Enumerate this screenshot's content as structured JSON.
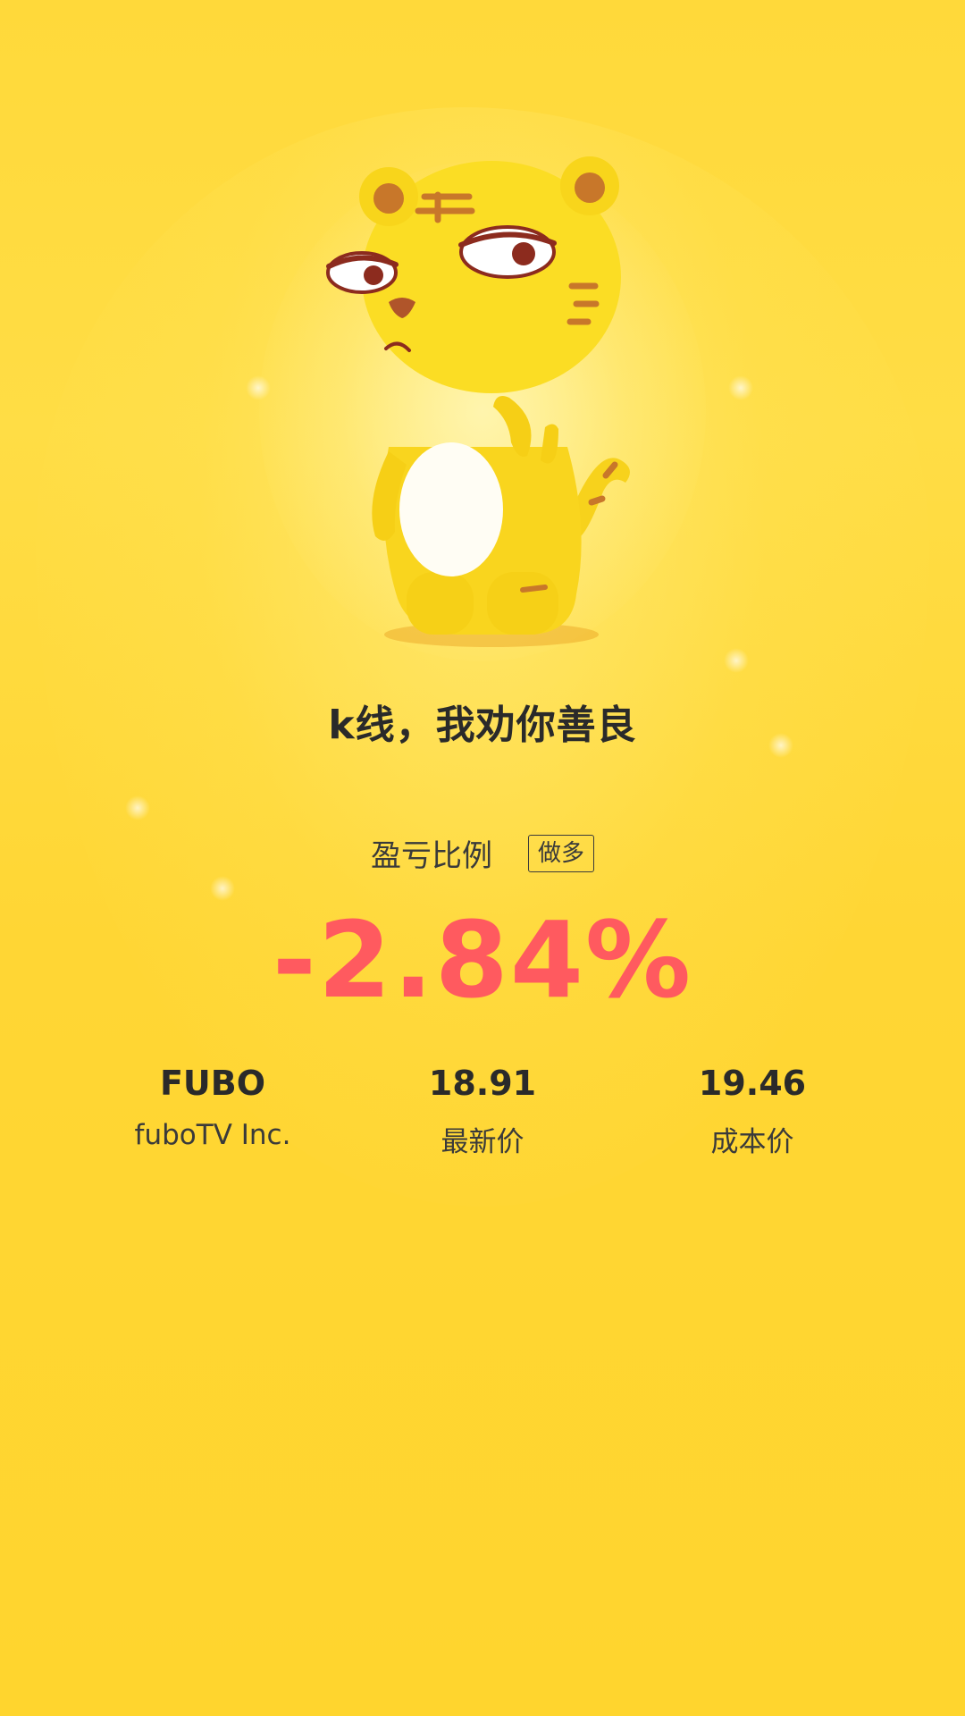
{
  "slogan": "k线，我劝你善良",
  "ratio": {
    "label": "盈亏比例",
    "direction_badge": "做多",
    "value": "-2.84%",
    "value_color": "#FF5A5F"
  },
  "stats": {
    "symbol": "FUBO",
    "company": "fuboTV Inc.",
    "latest_price": "18.91",
    "latest_price_label": "最新价",
    "cost_price": "19.46",
    "cost_price_label": "成本价"
  },
  "mascot": {
    "icon": "tiger-mascot-icon"
  },
  "colors": {
    "background": "#FFD93A",
    "loss": "#FF5A5F",
    "text": "#2a2a2a"
  }
}
